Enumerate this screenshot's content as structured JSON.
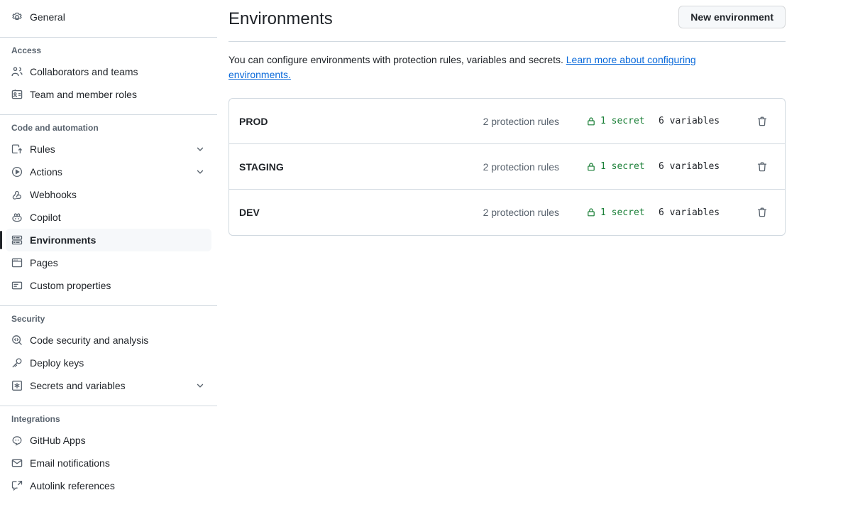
{
  "sidebar": {
    "top_items": [
      {
        "label": "General",
        "icon": "gear-icon",
        "name": "sidebar-item-general"
      }
    ],
    "sections": [
      {
        "title": "Access",
        "name": "sidebar-section-access",
        "items": [
          {
            "label": "Collaborators and teams",
            "icon": "people-icon",
            "name": "sidebar-item-collaborators-and-teams",
            "chevron": false
          },
          {
            "label": "Team and member roles",
            "icon": "id-badge-icon",
            "name": "sidebar-item-team-and-member-roles",
            "chevron": false
          }
        ]
      },
      {
        "title": "Code and automation",
        "name": "sidebar-section-code-and-automation",
        "items": [
          {
            "label": "Rules",
            "icon": "rules-icon",
            "name": "sidebar-item-rules",
            "chevron": true
          },
          {
            "label": "Actions",
            "icon": "play-icon",
            "name": "sidebar-item-actions",
            "chevron": true
          },
          {
            "label": "Webhooks",
            "icon": "webhook-icon",
            "name": "sidebar-item-webhooks",
            "chevron": false
          },
          {
            "label": "Copilot",
            "icon": "copilot-icon",
            "name": "sidebar-item-copilot",
            "chevron": false
          },
          {
            "label": "Environments",
            "icon": "server-icon",
            "name": "sidebar-item-environments",
            "chevron": false,
            "selected": true
          },
          {
            "label": "Pages",
            "icon": "browser-icon",
            "name": "sidebar-item-pages",
            "chevron": false
          },
          {
            "label": "Custom properties",
            "icon": "note-icon",
            "name": "sidebar-item-custom-properties",
            "chevron": false
          }
        ]
      },
      {
        "title": "Security",
        "name": "sidebar-section-security",
        "items": [
          {
            "label": "Code security and analysis",
            "icon": "codescan-icon",
            "name": "sidebar-item-code-security-and-analysis",
            "chevron": false
          },
          {
            "label": "Deploy keys",
            "icon": "key-icon",
            "name": "sidebar-item-deploy-keys",
            "chevron": false
          },
          {
            "label": "Secrets and variables",
            "icon": "asterisk-key-icon",
            "name": "sidebar-item-secrets-and-variables",
            "chevron": true
          }
        ]
      },
      {
        "title": "Integrations",
        "name": "sidebar-section-integrations",
        "items": [
          {
            "label": "GitHub Apps",
            "icon": "app-icon",
            "name": "sidebar-item-github-apps",
            "chevron": false
          },
          {
            "label": "Email notifications",
            "icon": "mail-icon",
            "name": "sidebar-item-email-notifications",
            "chevron": false
          },
          {
            "label": "Autolink references",
            "icon": "cross-reference-icon",
            "name": "sidebar-item-autolink-references",
            "chevron": false
          }
        ]
      }
    ]
  },
  "main": {
    "title": "Environments",
    "new_environment_button": "New environment",
    "description_text": "You can configure environments with protection rules, variables and secrets. ",
    "description_link": "Learn more about configuring environments.",
    "environments": [
      {
        "name": "PROD",
        "protection_rules": "2 protection rules",
        "secrets": "1 secret",
        "variables": "6 variables"
      },
      {
        "name": "STAGING",
        "protection_rules": "2 protection rules",
        "secrets": "1 secret",
        "variables": "6 variables"
      },
      {
        "name": "DEV",
        "protection_rules": "2 protection rules",
        "secrets": "1 secret",
        "variables": "6 variables"
      }
    ]
  },
  "colors": {
    "accent_link": "#0969da",
    "success_green": "#1a7f37",
    "muted_text": "#59636e",
    "border": "#d1d9e0",
    "selected_bg": "#f6f8fa"
  }
}
